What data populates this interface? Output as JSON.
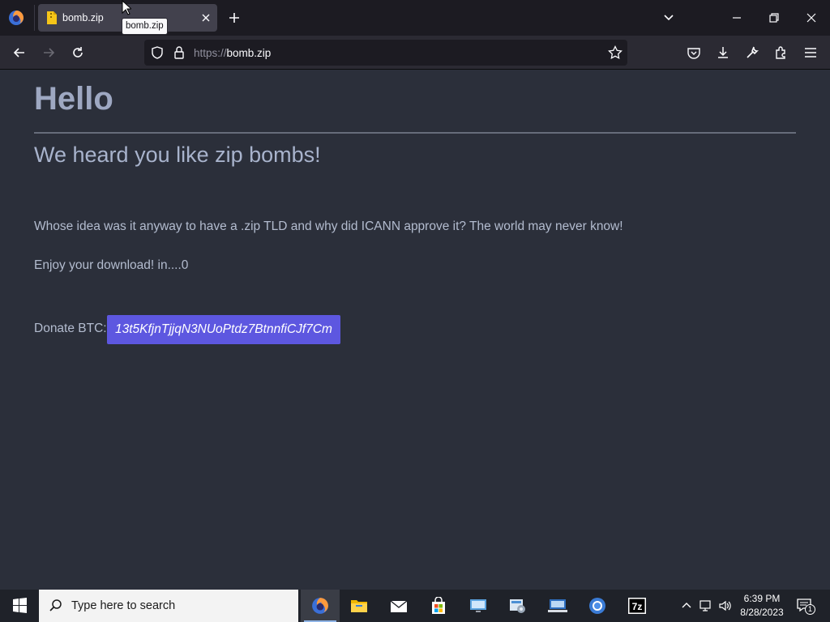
{
  "browser": {
    "tab": {
      "title": "bomb.zip",
      "tooltip": "bomb.zip"
    },
    "urlbar": {
      "scheme": "https://",
      "host": "bomb.zip"
    }
  },
  "page": {
    "heading": "Hello",
    "subheading": "We heard you like zip bombs!",
    "paragraph1": "Whose idea was it anyway to have a .zip TLD and why did ICANN approve it? The world may never know!",
    "paragraph2": "Enjoy your download! in....0",
    "donate_label": "Donate BTC:",
    "btc_address": "13t5KfjnTjjqN3NUoPtdz7BtnnfiCJf7Cm"
  },
  "taskbar": {
    "search_placeholder": "Type here to search",
    "apps": [
      "firefox-icon",
      "file-explorer-icon",
      "mail-icon",
      "store-icon",
      "remote-desktop-icon",
      "control-panel-icon",
      "network-icon",
      "chrome-icon",
      "7zip-icon"
    ],
    "clock_time": "6:39 PM",
    "clock_date": "8/28/2023",
    "notification_count": "1"
  },
  "colors": {
    "page_bg": "#2b2f3a",
    "btc_button": "#5d57e0",
    "heading": "#9ea8c2"
  }
}
